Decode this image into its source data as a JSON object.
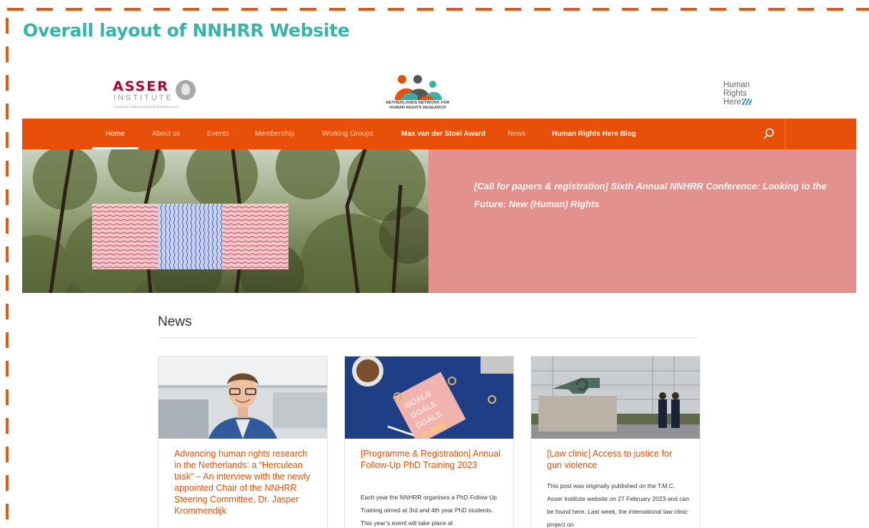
{
  "slide_title": "Overall layout of NNHRR Website",
  "logos": {
    "asser_name": "ASSER",
    "asser_sub": "INSTITUTE",
    "asser_tagline": "Centre for International & European Law",
    "nnhrr_line1": "NETHERLANDS NETWORK FOR",
    "nnhrr_line2": "HUMAN RIGHTS RESEARCH",
    "hrh_line1": "Human",
    "hrh_line2": "Rights",
    "hrh_line3": "Here"
  },
  "nav": {
    "items": [
      "Home",
      "About us",
      "Events",
      "Membership",
      "Working Groups",
      "Max van der Stoel Award",
      "News",
      "Human Rights Here Blog"
    ],
    "active": "Home",
    "search_icon": "search-icon"
  },
  "hero": {
    "text": "[Call for papers & registration] Sixth Annual NNHRR Conference: Looking to the Future: New (Human) Rights"
  },
  "news": {
    "heading": "News",
    "cards": [
      {
        "title": "Advancing human rights research in the Netherlands: a “Herculean task” – An interview with the newly appointed Chair of the NNHRR Steering Committee, Dr. Jasper Krommendijk",
        "text": ""
      },
      {
        "title": "[Programme & Registration] Annual Follow-Up PhD Training 2023",
        "text": "Each year the NNHRR organises a PhD Follow Up Training aimed at 3rd and 4th year PhD students. This year’s event will take place at"
      },
      {
        "title": "[Law clinic] Access to justice for gun violence",
        "text": "This post was originally published on the T.M.C. Asser Institute website on 27 February 2023 and can be found here. Last week, the international law clinic project on"
      }
    ]
  },
  "colors": {
    "accent": "#e8500a",
    "title_teal": "#37b3a8",
    "hero_panel": "#e3918e",
    "asser_red": "#b2002b"
  }
}
